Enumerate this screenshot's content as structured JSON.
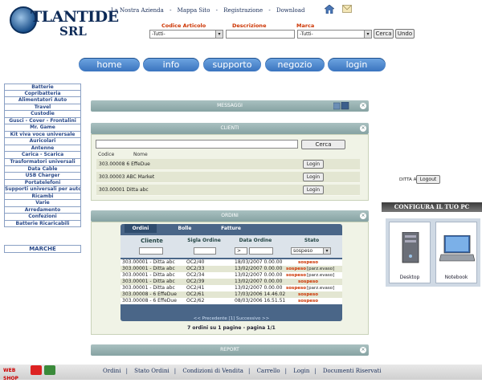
{
  "header": {
    "logo_line1": "TLANTIDE",
    "logo_line2": "SRL",
    "links": [
      "La Nostra Azienda",
      "Mappa Sito",
      "Registrazione",
      "Download"
    ],
    "link_separator": "-"
  },
  "search": {
    "codice_label": "Codice Articolo",
    "descrizione_label": "Descrizione",
    "marca_label": "Marca",
    "codice_value": "-Tutti-",
    "marca_value": "-Tutti-",
    "cerca_label": "Cerca",
    "undo_label": "Undo"
  },
  "nav": [
    "home",
    "info",
    "supporto",
    "negozio",
    "login"
  ],
  "sidebar": {
    "items": [
      "Batterie",
      "Copribatteria",
      "Alimentatori Auto",
      "Travel",
      "Custodie",
      "Gusci - Cover - Frontalini",
      "Mr. Game",
      "Kit viva voce universale",
      "Auricolari",
      "Antenne",
      "Carica - Scarica",
      "Trasformatori universali",
      "Data Cable",
      "USB Charger",
      "Portatelefoni",
      "Supporti universali per auto",
      "Ricambi",
      "Varie",
      "Arredamento",
      "Confezioni",
      "Batterie Ricaricabili"
    ],
    "marche": "MARCHE"
  },
  "messaggi": {
    "title": "MESSAGGI"
  },
  "clienti": {
    "title": "CLIENTI",
    "cerca_label": "Cerca",
    "columns": [
      "Codice",
      "Nome"
    ],
    "rows": [
      {
        "codice": "303.00008",
        "nome": "6 EffeDue",
        "action": "Login"
      },
      {
        "codice": "303.00003",
        "nome": "ABC Market",
        "action": "Login"
      },
      {
        "codice": "303.00001",
        "nome": "Ditta abc",
        "action": "Login"
      }
    ]
  },
  "ordini": {
    "title": "ORDINI",
    "tabs": [
      "Ordini",
      "Bolle",
      "Fatture"
    ],
    "columns": [
      "Cliente",
      "Sigla Ordine",
      "Data Ordine",
      "Stato"
    ],
    "date_op": ">",
    "stato_filter": "sospeso",
    "rows": [
      {
        "cliente": "303.00001 - Ditta abc",
        "sigla": "OC2/40",
        "data": "18/03/2007 0.00.00",
        "stato": "sospeso",
        "extra": ""
      },
      {
        "cliente": "303.00001 - Ditta abc",
        "sigla": "OC2/33",
        "data": "13/02/2007 0.00.00",
        "stato": "sospeso",
        "extra": "[parz.evaso]"
      },
      {
        "cliente": "303.00001 - Ditta abc",
        "sigla": "OC2/34",
        "data": "13/02/2007 0.00.00",
        "stato": "sospeso",
        "extra": "[parz.evaso]"
      },
      {
        "cliente": "303.00001 - Ditta abc",
        "sigla": "OC2/39",
        "data": "13/02/2007 0.00.00",
        "stato": "sospeso",
        "extra": ""
      },
      {
        "cliente": "303.00001 - Ditta abc",
        "sigla": "OC2/41",
        "data": "13/02/2007 0.00.00",
        "stato": "sospeso",
        "extra": "[parz.evaso]"
      },
      {
        "cliente": "303.00008 - 6 EffeDue",
        "sigla": "OC2/61",
        "data": "17/03/2006 14.46.02",
        "stato": "sospeso",
        "extra": ""
      },
      {
        "cliente": "303.00008 - 6 EffeDue",
        "sigla": "OC2/62",
        "data": "08/03/2006 16.51.51",
        "stato": "sospeso",
        "extra": ""
      }
    ],
    "pager": "<< Precedente  [1]  Successivo >>",
    "summary": "7 ordini su 1 pagine - pagina 1/1"
  },
  "report": {
    "title": "REPORT"
  },
  "user": {
    "name": "DITTA ABC",
    "logout_label": "Logout"
  },
  "configura": {
    "title": "CONFIGURA IL TUO PC",
    "options": [
      "Desktop",
      "Notebook"
    ]
  },
  "footer": {
    "webshop": "WEB SHOP",
    "links": [
      "Ordini",
      "Stato Ordini",
      "Condizioni di Vendita",
      "Carrello",
      "Login",
      "Documenti Riservati"
    ]
  },
  "colors": {
    "accent": "#3a74bf",
    "panel": "#86a3a3",
    "alert": "#cc3300"
  }
}
